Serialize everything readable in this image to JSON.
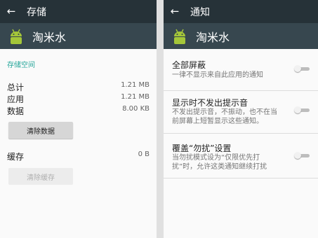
{
  "left": {
    "header_title": "存储",
    "app_name": "淘米水",
    "section_label": "存储空间",
    "stats": [
      {
        "label": "总计",
        "value": "1.21 MB"
      },
      {
        "label": "应用",
        "value": "1.21 MB"
      },
      {
        "label": "数据",
        "value": "8.00 KB"
      }
    ],
    "clear_data_label": "清除数据",
    "cache_label": "缓存",
    "cache_value": "0 B",
    "clear_cache_label": "清除缓存"
  },
  "right": {
    "header_title": "通知",
    "app_name": "淘米水",
    "settings": [
      {
        "title": "全部屏蔽",
        "desc": "一律不显示来自此应用的通知",
        "enabled": false
      },
      {
        "title": "显示时不发出提示音",
        "desc": "不发出提示音，不振动，也不在当前屏幕上短暂显示这些通知。",
        "enabled": false
      },
      {
        "title": "覆盖“勿扰”设置",
        "desc": "当勿扰模式设为“仅限优先打扰”时，允许这类通知继续打扰",
        "enabled": false
      }
    ]
  },
  "icons": {
    "back": "back-arrow-icon",
    "app": "android-icon"
  },
  "colors": {
    "header": "#263238",
    "app_bar": "#37474f",
    "accent": "#26a69a",
    "android_green": "#a4c639"
  }
}
